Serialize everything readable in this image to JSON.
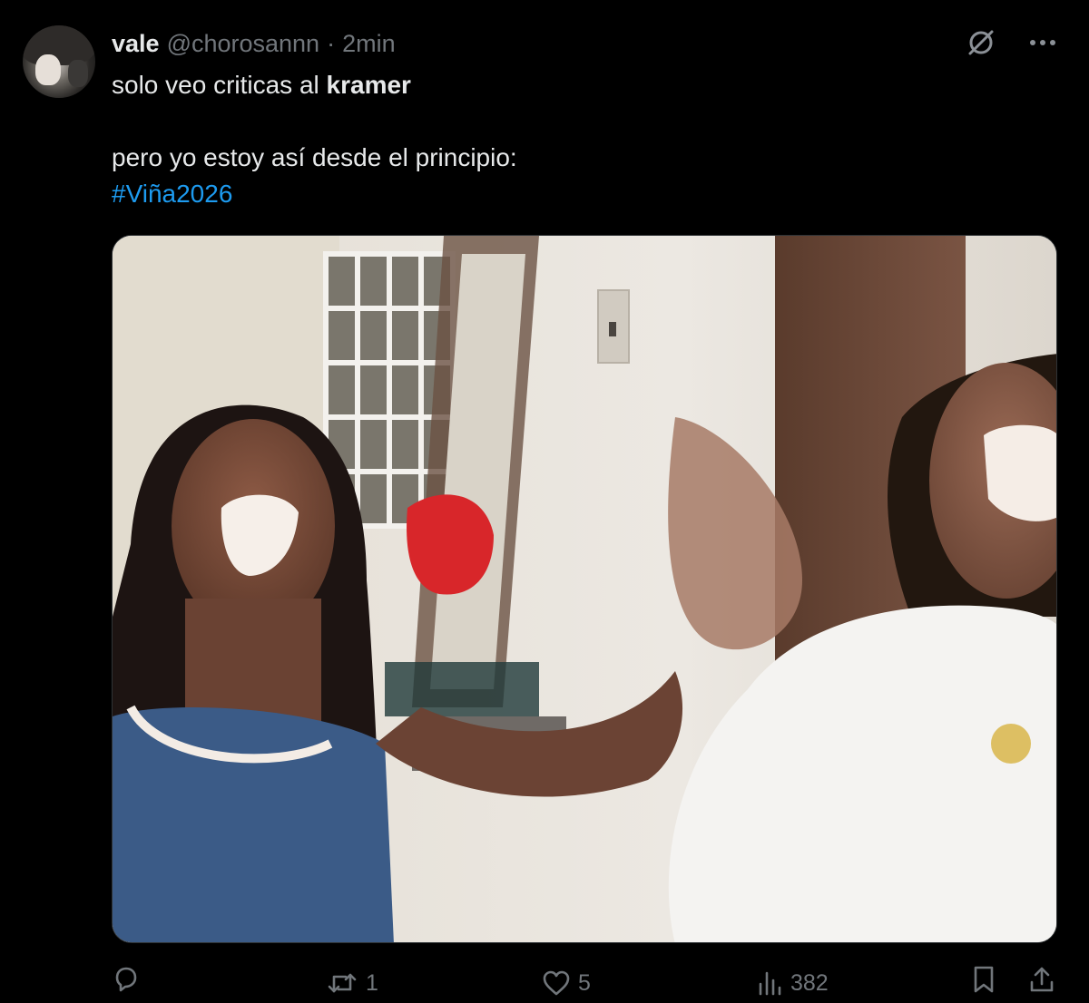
{
  "tweet": {
    "display_name": "vale",
    "handle": "@chorosannn",
    "separator": "·",
    "time": "2min",
    "text_line1_prefix": "solo veo criticas al ",
    "text_line1_bold": "kramer",
    "text_line2": "pero yo estoy así desde el principio:",
    "hashtag": "#Viña2026"
  },
  "icons": {
    "grok": "grok-icon",
    "more": "more-icon",
    "reply": "reply-icon",
    "retweet": "retweet-icon",
    "like": "heart-icon",
    "views": "views-icon",
    "bookmark": "bookmark-icon",
    "share": "share-icon"
  },
  "metrics": {
    "retweets": "1",
    "likes": "5",
    "views": "382"
  },
  "colors": {
    "background": "#000000",
    "text": "#e7e9ea",
    "secondary": "#71767b",
    "link": "#1d9bf0"
  }
}
